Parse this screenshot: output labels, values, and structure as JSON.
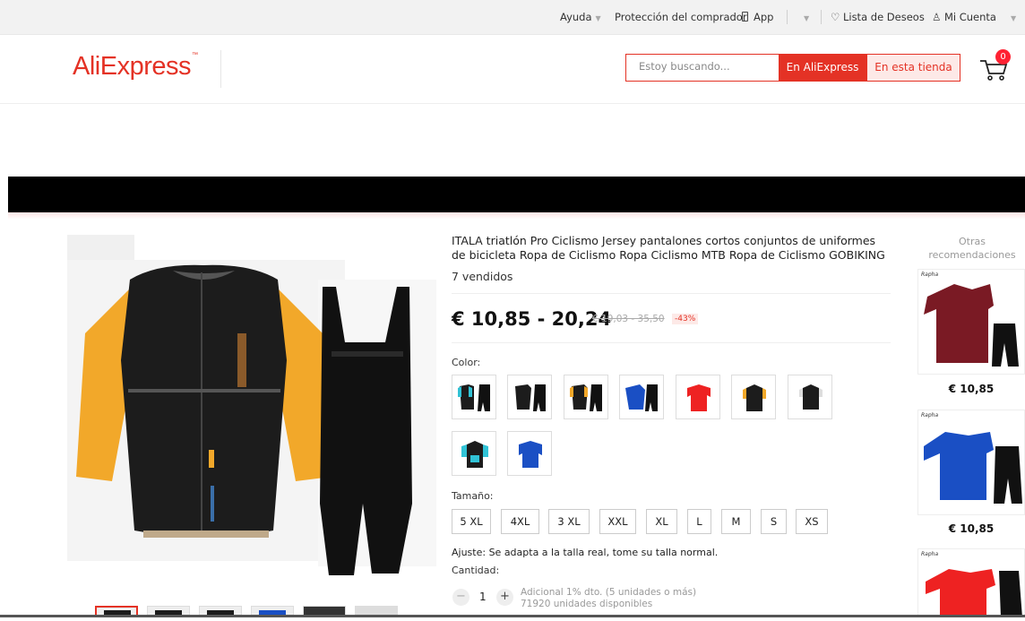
{
  "topbar": {
    "help": "Ayuda",
    "buyer_protection": "Protección del comprador",
    "app": "App",
    "wishlist": "Lista de Deseos",
    "account": "Mi Cuenta"
  },
  "header": {
    "logo": "AliExpress",
    "search_placeholder": "Estoy buscando...",
    "btn_all": "En AliExpress",
    "btn_store": "En esta tienda",
    "cart_count": "0"
  },
  "product": {
    "title": "ITALA triatlón Pro Ciclismo Jersey pantalones cortos conjuntos de uniformes de bicicleta Ropa de Ciclismo Ropa Ciclismo MTB Ropa de Ciclismo GOBIKING",
    "sold": "7 vendidos",
    "price": "€ 10,85 - 20,24",
    "old_price": "€ 19,03 - 35,50",
    "discount": "-43%",
    "color_label": "Color:",
    "size_label": "Tamaño:",
    "sizes": [
      "5 XL",
      "4XL",
      "3 XL",
      "XXL",
      "XL",
      "L",
      "M",
      "S",
      "XS"
    ],
    "fit": "Ajuste: Se adapta a la talla real, tome su talla normal.",
    "quantity_label": "Cantidad:",
    "quantity": "1",
    "qty_discount": "Adicional 1% dto. (5 unidades o más)",
    "stock": "71920 unidades disponibles"
  },
  "recommendations": {
    "title": "Otras recomendaciones",
    "brand": "Rapha",
    "items": [
      {
        "price": "€ 10,85"
      },
      {
        "price": "€ 10,85"
      },
      {
        "price": ""
      }
    ]
  },
  "colors": {
    "brand": "#e43225",
    "jersey_black": "#1a1a1a",
    "sleeve_yellow": "#f2a82a"
  }
}
